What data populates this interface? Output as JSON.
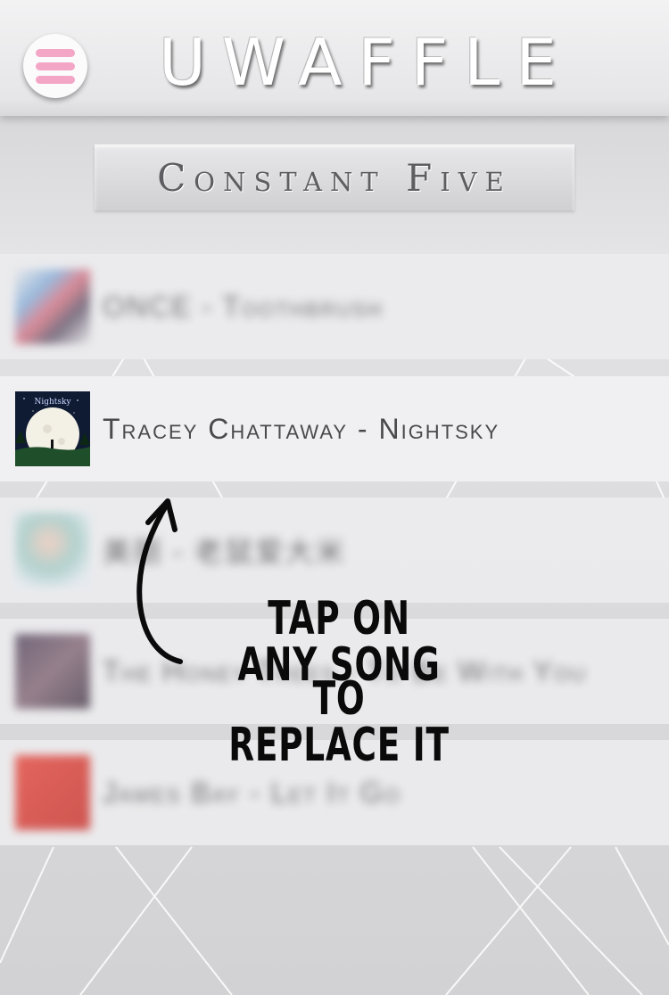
{
  "header": {
    "title": "UWAFFLE",
    "menu_icon": "hamburger-menu-icon",
    "menu_color": "#f3a6c6"
  },
  "playlist": {
    "name": "Constant Five"
  },
  "songs": [
    {
      "title": "ONCE - Toothbrush",
      "state": "blurred"
    },
    {
      "title": "Tracey Chattaway - Nightsky",
      "state": "focused",
      "art_label": "Nightsky"
    },
    {
      "title": "美丽 - 老鼠爱大米",
      "state": "blurred"
    },
    {
      "title": "The Honey Trees - To Be With You",
      "state": "blurred"
    },
    {
      "title": "James Bay - Let It Go",
      "state": "blurred"
    }
  ],
  "hint": {
    "line1": "TAP ON ANY SONG",
    "line2": "TO REPLACE IT",
    "arrow_icon": "curved-arrow-up-icon"
  }
}
